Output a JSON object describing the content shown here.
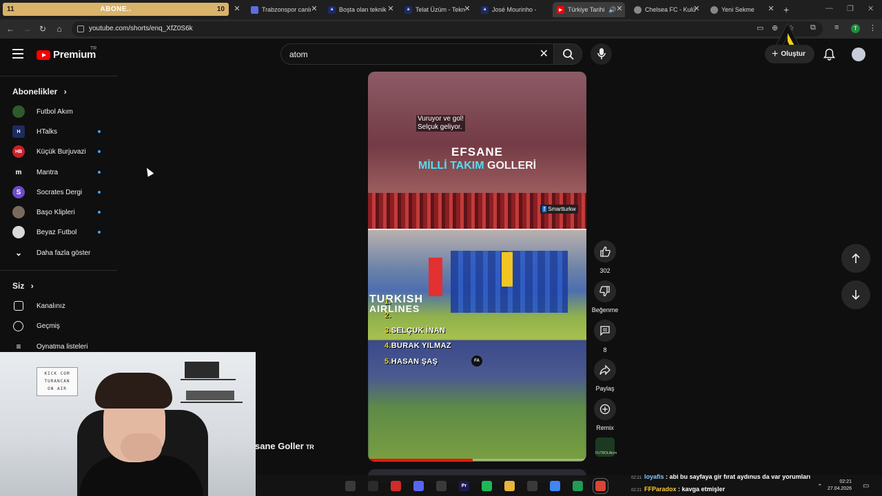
{
  "browser": {
    "progress_tab": {
      "left": "11",
      "center": "ABONE..",
      "right": "10"
    },
    "tabs": [
      {
        "title": "Trabzonspor canlı",
        "favicon": "trabzonspor-icon",
        "color": "#5b6ee1"
      },
      {
        "title": "Boşta olan teknik",
        "favicon": "ajans-icon",
        "color": "#1a2a6c"
      },
      {
        "title": "Telat Üzüm - Tekn",
        "favicon": "ajans-icon",
        "color": "#1a2a6c"
      },
      {
        "title": "José Mourinho -",
        "favicon": "ajans-icon",
        "color": "#1a2a6c"
      },
      {
        "title": "Türkiye Tarihi",
        "favicon": "youtube-icon",
        "color": "#ff0000"
      },
      {
        "title": "Chelsea FC - Kulü",
        "favicon": "globe-icon",
        "color": "#888888"
      },
      {
        "title": "Yeni Sekme",
        "favicon": "chrome-icon",
        "color": "#888888"
      }
    ],
    "new_tab": "+",
    "url": "youtube.com/shorts/enq_XfZ0S6k",
    "profile_initial": "T"
  },
  "header": {
    "logo": "Premium",
    "region": "TR",
    "search_query": "atom",
    "create_label": "Oluştur"
  },
  "sidebar": {
    "subscriptions_heading": "Abonelikler",
    "channels": [
      {
        "label": "Futbol Akım",
        "icon": "futbol-akim-avatar",
        "color": "#2f5a2c",
        "new": false
      },
      {
        "label": "HTalks",
        "icon": "htalks-avatar",
        "color": "#1d2b5f",
        "new": true
      },
      {
        "label": "Küçük Burjuvazi",
        "icon": "kucuk-burjuvazi-avatar",
        "color": "#c8202a",
        "new": true
      },
      {
        "label": "Mantra",
        "icon": "mantra-avatar",
        "color": "#111111",
        "new": true
      },
      {
        "label": "Socrates Dergi",
        "icon": "socrates-avatar",
        "color": "#6d4bc7",
        "new": true
      },
      {
        "label": "Başo Klipleri",
        "icon": "baso-avatar",
        "color": "#7a6a5e",
        "new": true
      },
      {
        "label": "Beyaz Futbol",
        "icon": "beyaz-futbol-avatar",
        "color": "#d9d9d9",
        "new": true
      }
    ],
    "show_more": "Daha fazla göster",
    "you_heading": "Siz",
    "you_items": [
      {
        "label": "Kanalınız",
        "icon": "channel-icon"
      },
      {
        "label": "Geçmiş",
        "icon": "history-icon"
      },
      {
        "label": "Oynatma listeleri",
        "icon": "playlist-icon"
      }
    ]
  },
  "video": {
    "caption_line1": "Vuruyor ve gol!",
    "caption_line2": "Selçuk geliyor.",
    "title_line1": "EFSANE",
    "title_word_a": "MİLLİ TAKIM",
    "title_word_b": "GOLLERİ",
    "page_tag": "Smartturkw",
    "stadium_text_1": "TURKISH",
    "stadium_text_2": "AIRLINES",
    "list": [
      {
        "n": "1.",
        "name": ""
      },
      {
        "n": "2.",
        "name": ""
      },
      {
        "n": "3.",
        "name": "SELÇUK İNAN"
      },
      {
        "n": "4.",
        "name": "BURAK YILMAZ"
      },
      {
        "n": "5.",
        "name": "HASAN ŞAŞ"
      }
    ],
    "watermark": "FA",
    "progress": 0.48
  },
  "actions": {
    "like_count": "302",
    "dislike_label": "Beğenme",
    "comment_count": "8",
    "share_label": "Paylaş",
    "remix_label": "Remix",
    "channel_thumb_text": "FUTBOLAkım"
  },
  "background_title": {
    "text": "sane Goller",
    "suffix": "TR"
  },
  "webcam": {
    "sign_lines": [
      "KICK COM",
      "TURANCAN",
      "ON AIR"
    ]
  },
  "chat": [
    {
      "time": "02:21",
      "user": "loyafis",
      "message": " : abi bu sayfaya gir fırat aydınus da var yorumları"
    },
    {
      "time": "02:21",
      "user": "FFParadox",
      "message": " : kavga etmişler"
    }
  ],
  "taskbar": {
    "icons": [
      {
        "name": "app-icon-1",
        "label": "",
        "color": "#3a3a3a"
      },
      {
        "name": "obs-icon",
        "label": "",
        "color": "#2b2b2b"
      },
      {
        "name": "app-icon-red",
        "label": "",
        "color": "#d22b2b"
      },
      {
        "name": "discord-icon",
        "label": "",
        "color": "#5865f2"
      },
      {
        "name": "app-icon-2",
        "label": "",
        "color": "#3a3a3a"
      },
      {
        "name": "premiere-icon",
        "label": "Pr",
        "color": "#1d1a4d"
      },
      {
        "name": "spotify-icon",
        "label": "",
        "color": "#1db954"
      },
      {
        "name": "folder-icon",
        "label": "",
        "color": "#e8b43c"
      },
      {
        "name": "app-icon-3",
        "label": "",
        "color": "#3a3a3a"
      },
      {
        "name": "chrome-icon",
        "label": "",
        "color": "#4285f4"
      },
      {
        "name": "app-icon-green",
        "label": "",
        "color": "#1f9c55"
      },
      {
        "name": "chrome-active-icon",
        "label": "",
        "color": "#db4437"
      }
    ],
    "time": "02:21",
    "date": "27.04.2026"
  }
}
